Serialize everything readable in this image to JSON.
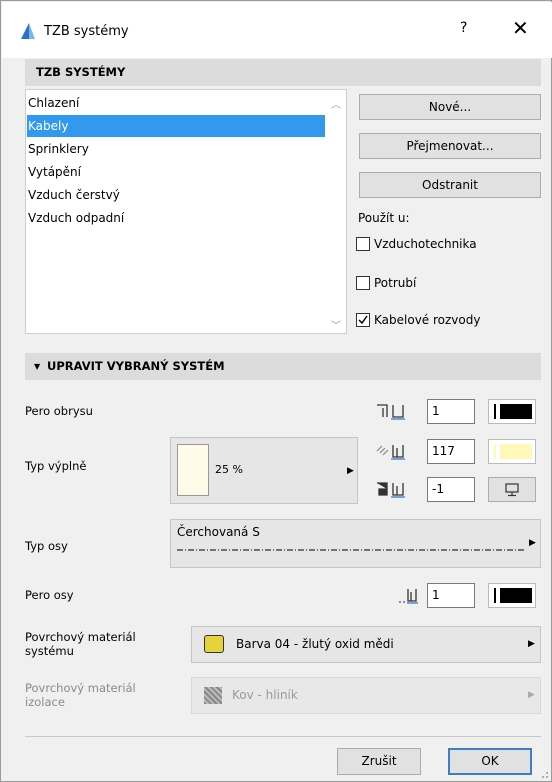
{
  "window": {
    "title": "TZB systémy",
    "help_label": "?",
    "close_label": "✕"
  },
  "systems_section": {
    "header": "TZB SYSTÉMY",
    "items": [
      "Chlazení",
      "Kabely",
      "Sprinklery",
      "Vytápění",
      "Vzduch čerstvý",
      "Vzduch odpadní"
    ],
    "selected_index": 1,
    "buttons": {
      "new": "Nové...",
      "rename": "Přejmenovat...",
      "delete": "Odstranit"
    },
    "use_for_label": "Použít u:",
    "use_for": [
      {
        "label": "Vzduchotechnika",
        "checked": false
      },
      {
        "label": "Potrubí",
        "checked": false
      },
      {
        "label": "Kabelové rozvody",
        "checked": true
      }
    ]
  },
  "edit_section": {
    "header": "UPRAVIT VYBRANÝ SYSTÉM",
    "contour_pen": {
      "label": "Pero obrysu",
      "value": "1",
      "color": "#000000"
    },
    "fill_type": {
      "label": "Typ výplně",
      "pattern": "25 %",
      "pattern_color": "#fffbe8",
      "foreground_pen": "117",
      "foreground_color": "#fff8b8",
      "background_pen": "-1"
    },
    "axis_type": {
      "label": "Typ osy",
      "value": "Čerchovaná S"
    },
    "axis_pen": {
      "label": "Pero osy",
      "value": "1",
      "color": "#000000"
    },
    "system_material": {
      "label_line1": "Povrchový materiál",
      "label_line2": "systému",
      "value": "Barva 04 - žlutý oxid mědi",
      "color": "#e6d33c"
    },
    "insulation_material": {
      "label_line1": "Povrchový materiál",
      "label_line2": "izolace",
      "value": "Kov - hliník"
    }
  },
  "footer": {
    "cancel": "Zrušit",
    "ok": "OK"
  },
  "colors": {
    "selection": "#3399ee",
    "section_header": "#dcdcdc",
    "ok_border": "#3c7fc2"
  }
}
